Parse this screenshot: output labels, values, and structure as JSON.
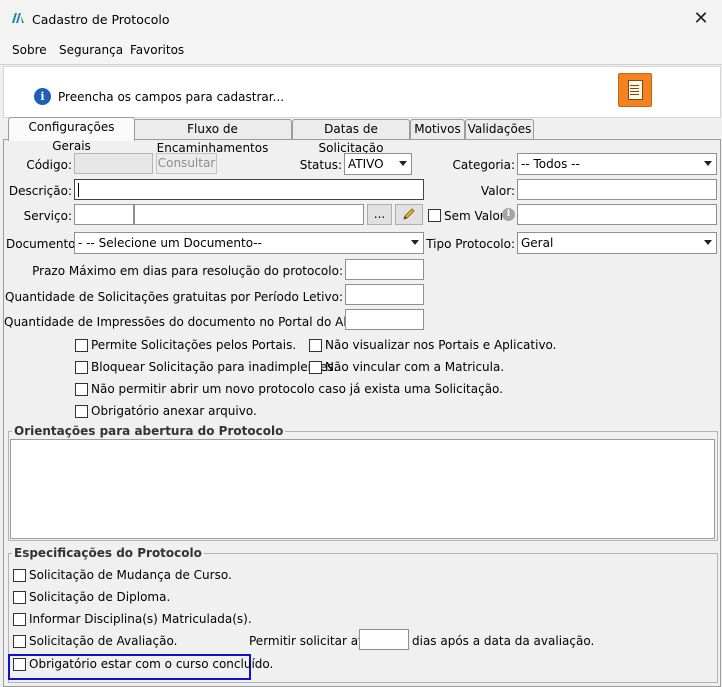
{
  "window": {
    "title": "Cadastro de Protocolo",
    "close_glyph": "✕"
  },
  "menu": [
    "Sobre",
    "Segurança",
    "Favoritos"
  ],
  "header": {
    "info_text": "Preencha os campos para cadastrar..."
  },
  "tabs": [
    "Configurações Gerais",
    "Fluxo de Encaminhamentos",
    "Datas de Solicitação",
    "Motivos",
    "Validações"
  ],
  "form": {
    "codigo_label": "Código:",
    "consultar_label": "Consultar",
    "status_label": "Status:",
    "status_value": "ATIVO",
    "categoria_label": "Categoria:",
    "categoria_value": "-- Todos --",
    "descricao_label": "Descrição:",
    "valor_label": "Valor:",
    "servico_label": "Serviço:",
    "ellipsis_label": "...",
    "sem_valor_label": "Sem Valor",
    "documento_label": "Documento:",
    "documento_value": "- -- Selecione um Documento--",
    "tipo_protocolo_label": "Tipo Protocolo:",
    "tipo_protocolo_value": "Geral",
    "prazo_label": "Prazo Máximo em dias para resolução do protocolo:",
    "qtd_solic_label": "Quantidade de Solicitações gratuitas por Período Letivo:",
    "qtd_impr_label": "Quantidade de Impressões do documento no Portal do Aluno:"
  },
  "checkboxes": {
    "permite_portais": "Permite Solicitações pelos Portais.",
    "nao_visualizar": "Não visualizar nos Portais e Aplicativo.",
    "bloquear_inadimplentes": "Bloquear Solicitação para inadimplentes.",
    "nao_vincular": "Não vincular com a Matricula.",
    "nao_permitir_novo": "Não permitir abrir um novo protocolo caso já exista uma Solicitação.",
    "obrigatorio_anexar": "Obrigatório anexar arquivo."
  },
  "orientacoes": {
    "title": "Orientações para abertura do Protocolo"
  },
  "especificacoes": {
    "title": "Especificações do Protocolo",
    "mudanca_curso": "Solicitação de Mudança de Curso.",
    "diploma": "Solicitação de Diploma.",
    "disciplinas": "Informar Disciplina(s) Matriculada(s).",
    "avaliacao": "Solicitação de Avaliação.",
    "permitir_ate": "Permitir solicitar até:",
    "dias_apos": "dias após a data da avaliação.",
    "curso_concluido": "Obrigatório estar com o curso concluído."
  },
  "colors": {
    "accent_orange": "#f58220",
    "info_blue": "#1d5fb8",
    "highlight_blue": "#1010d0"
  }
}
